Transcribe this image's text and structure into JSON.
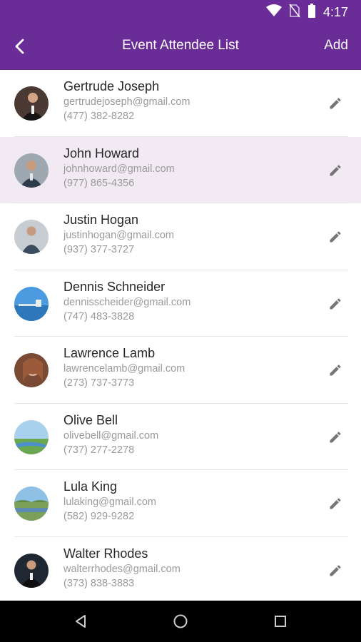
{
  "status_bar": {
    "time": "4:17",
    "icons": [
      "wifi-icon",
      "no-sim-icon",
      "battery-icon"
    ]
  },
  "app_bar": {
    "title": "Event Attendee List",
    "action_label": "Add",
    "back_icon": "back-arrow-icon",
    "color": "#6a2c96"
  },
  "attendees": [
    {
      "name": "Gertrude Joseph",
      "email": "gertrudejoseph@gmail.com",
      "phone": "(477) 382-8282",
      "selected": false
    },
    {
      "name": "John Howard",
      "email": "johnhoward@gmail.com",
      "phone": "(977) 865-4356",
      "selected": true
    },
    {
      "name": "Justin Hogan",
      "email": "justinhogan@gmail.com",
      "phone": "(937) 377-3727",
      "selected": false
    },
    {
      "name": "Dennis Schneider",
      "email": "dennisscheider@gmail.com",
      "phone": "(747) 483-3828",
      "selected": false
    },
    {
      "name": "Lawrence Lamb",
      "email": "lawrencelamb@gmail.com",
      "phone": "(273) 737-3773",
      "selected": false
    },
    {
      "name": "Olive Bell",
      "email": "olivebell@gmail.com",
      "phone": "(737) 277-2278",
      "selected": false
    },
    {
      "name": "Lula King",
      "email": "lulaking@gmail.com",
      "phone": "(582) 929-9282",
      "selected": false
    },
    {
      "name": "Walter Rhodes",
      "email": "walterrhodes@gmail.com",
      "phone": "(373) 838-3883",
      "selected": false
    }
  ],
  "nav_bar": {
    "icons": [
      "back-triangle-icon",
      "home-circle-icon",
      "recents-square-icon"
    ]
  }
}
